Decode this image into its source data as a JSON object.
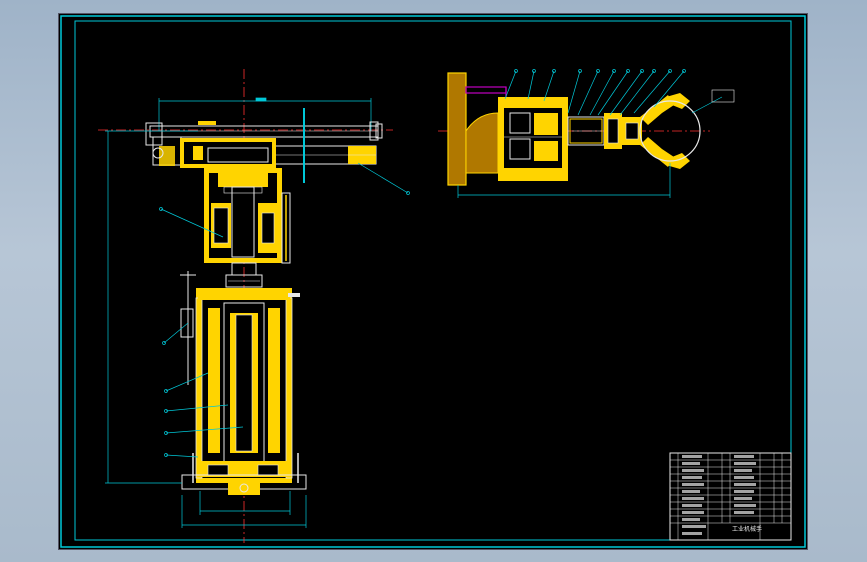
{
  "colors": {
    "background": "#000000",
    "frame": "#00c8d8",
    "part": "#ffd400",
    "hatch": "#8a6d00",
    "centerline": "#ff3030",
    "dimension": "#00c8d8",
    "body_line": "#e8e8e8",
    "accent": "#c000c0",
    "gripper_fill": "#b07800"
  },
  "title_block": {
    "title": "工业机械手"
  }
}
